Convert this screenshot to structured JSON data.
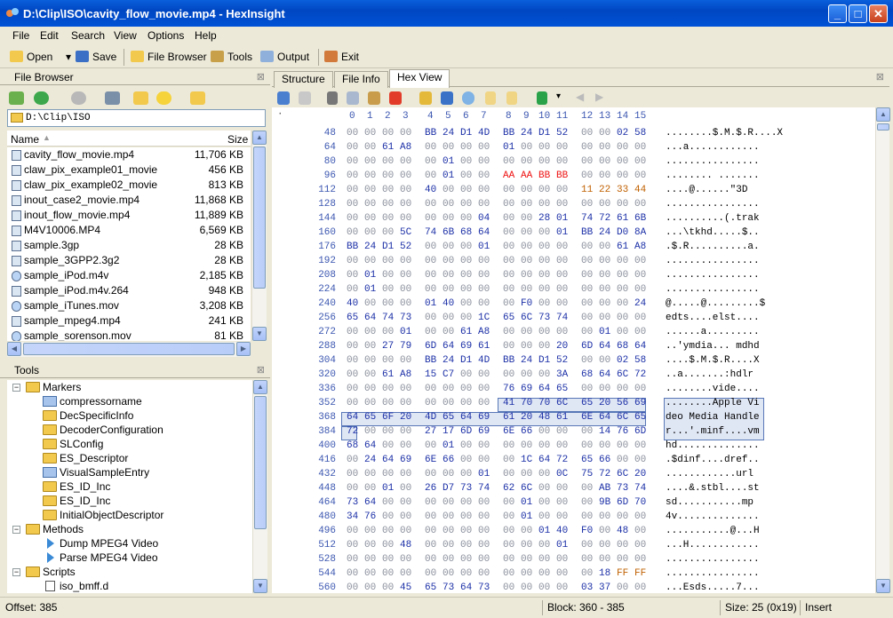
{
  "window": {
    "title": "D:\\Clip\\ISO\\cavity_flow_movie.mp4 - HexInsight"
  },
  "menu": [
    "File",
    "Edit",
    "Search",
    "View",
    "Options",
    "Help"
  ],
  "toolbar": {
    "open": "Open",
    "save": "Save",
    "file_browser": "File Browser",
    "tools": "Tools",
    "output": "Output",
    "exit": "Exit"
  },
  "file_browser": {
    "title": "File Browser",
    "path": "D:\\Clip\\ISO",
    "col_name": "Name",
    "col_size": "Size",
    "files": [
      {
        "name": "cavity_flow_movie.mp4",
        "size": "11,706 KB",
        "icon": "video-file-icon"
      },
      {
        "name": "claw_pix_example01_movie....",
        "size": "456 KB",
        "icon": "video-file-icon"
      },
      {
        "name": "claw_pix_example02_movie....",
        "size": "813 KB",
        "icon": "video-file-icon"
      },
      {
        "name": "inout_case2_movie.mp4",
        "size": "11,868 KB",
        "icon": "video-file-icon"
      },
      {
        "name": "inout_flow_movie.mp4",
        "size": "11,889 KB",
        "icon": "video-file-icon"
      },
      {
        "name": "M4V10006.MP4",
        "size": "6,569 KB",
        "icon": "video-file-icon"
      },
      {
        "name": "sample.3gp",
        "size": "28 KB",
        "icon": "video-file-icon"
      },
      {
        "name": "sample_3GPP2.3g2",
        "size": "28 KB",
        "icon": "video-file-icon"
      },
      {
        "name": "sample_iPod.m4v",
        "size": "2,185 KB",
        "icon": "quicktime-icon"
      },
      {
        "name": "sample_iPod.m4v.264",
        "size": "948 KB",
        "icon": "video-file-icon"
      },
      {
        "name": "sample_iTunes.mov",
        "size": "3,208 KB",
        "icon": "quicktime-icon"
      },
      {
        "name": "sample_mpeg4.mp4",
        "size": "241 KB",
        "icon": "video-file-icon"
      },
      {
        "name": "sample_sorenson.mov",
        "size": "81 KB",
        "icon": "quicktime-icon"
      }
    ]
  },
  "tools_panel": {
    "title": "Tools",
    "nodes": [
      {
        "label": "Markers",
        "level": 0,
        "icon": "folder-icon",
        "expander": "−"
      },
      {
        "label": "compressorname",
        "level": 1,
        "icon": "block-icon"
      },
      {
        "label": "DecSpecificInfo",
        "level": 1,
        "icon": "folder-icon"
      },
      {
        "label": "DecoderConfiguration",
        "level": 1,
        "icon": "folder-icon"
      },
      {
        "label": "SLConfig",
        "level": 1,
        "icon": "folder-icon"
      },
      {
        "label": "ES_Descriptor",
        "level": 1,
        "icon": "folder-icon"
      },
      {
        "label": "VisualSampleEntry",
        "level": 1,
        "icon": "block-icon"
      },
      {
        "label": "ES_ID_Inc",
        "level": 1,
        "icon": "folder-icon"
      },
      {
        "label": "ES_ID_Inc",
        "level": 1,
        "icon": "folder-icon"
      },
      {
        "label": "InitialObjectDescriptor",
        "level": 1,
        "icon": "folder-icon"
      },
      {
        "label": "Methods",
        "level": 0,
        "icon": "folder-icon",
        "expander": "−"
      },
      {
        "label": "Dump MPEG4 Video",
        "level": 1,
        "icon": "play-icon"
      },
      {
        "label": "Parse MPEG4 Video",
        "level": 1,
        "icon": "play-icon"
      },
      {
        "label": "Scripts",
        "level": 0,
        "icon": "folder-icon",
        "expander": "−"
      },
      {
        "label": "iso_bmff.d",
        "level": 1,
        "icon": "document-icon"
      }
    ]
  },
  "tabs": [
    {
      "label": "Structure",
      "active": false
    },
    {
      "label": "File Info",
      "active": false
    },
    {
      "label": "Hex View",
      "active": true
    }
  ],
  "hex": {
    "columns": [
      "0",
      "1",
      "2",
      "3",
      "4",
      "5",
      "6",
      "7",
      "8",
      "9",
      "10",
      "11",
      "12",
      "13",
      "14",
      "15"
    ],
    "selection": "Apple Video Media Handler",
    "rows": [
      {
        "off": "48",
        "b": [
          "00",
          "00",
          "00",
          "00",
          "BB",
          "24",
          "D1",
          "4D",
          "BB",
          "24",
          "D1",
          "52",
          "00",
          "00",
          "02",
          "58"
        ],
        "a": "........$.M.$.R....X"
      },
      {
        "off": "64",
        "b": [
          "00",
          "00",
          "61",
          "A8",
          "00",
          "00",
          "00",
          "00",
          "01",
          "00",
          "00",
          "00",
          "00",
          "00",
          "00",
          "00"
        ],
        "a": "...a............"
      },
      {
        "off": "80",
        "b": [
          "00",
          "00",
          "00",
          "00",
          "00",
          "01",
          "00",
          "00",
          "00",
          "00",
          "00",
          "00",
          "00",
          "00",
          "00",
          "00"
        ],
        "a": "................"
      },
      {
        "off": "96",
        "b": [
          "00",
          "00",
          "00",
          "00",
          "00",
          "01",
          "00",
          "00",
          "AA",
          "AA",
          "BB",
          "BB",
          "00",
          "00",
          "00",
          "00"
        ],
        "a": "........ ....... "
      },
      {
        "off": "112",
        "b": [
          "00",
          "00",
          "00",
          "00",
          "40",
          "00",
          "00",
          "00",
          "00",
          "00",
          "00",
          "00",
          "11",
          "22",
          "33",
          "44"
        ],
        "a": "....@......\"3D"
      },
      {
        "off": "128",
        "b": [
          "00",
          "00",
          "00",
          "00",
          "00",
          "00",
          "00",
          "00",
          "00",
          "00",
          "00",
          "00",
          "00",
          "00",
          "00",
          "00"
        ],
        "a": "................"
      },
      {
        "off": "144",
        "b": [
          "00",
          "00",
          "00",
          "00",
          "00",
          "00",
          "00",
          "04",
          "00",
          "00",
          "28",
          "01",
          "74",
          "72",
          "61",
          "6B"
        ],
        "a": "..........(.trak"
      },
      {
        "off": "160",
        "b": [
          "00",
          "00",
          "00",
          "5C",
          "74",
          "6B",
          "68",
          "64",
          "00",
          "00",
          "00",
          "01",
          "BB",
          "24",
          "D0",
          "8A"
        ],
        "a": "...\\tkhd.....$.."
      },
      {
        "off": "176",
        "b": [
          "BB",
          "24",
          "D1",
          "52",
          "00",
          "00",
          "00",
          "01",
          "00",
          "00",
          "00",
          "00",
          "00",
          "00",
          "61",
          "A8"
        ],
        "a": ".$.R..........a."
      },
      {
        "off": "192",
        "b": [
          "00",
          "00",
          "00",
          "00",
          "00",
          "00",
          "00",
          "00",
          "00",
          "00",
          "00",
          "00",
          "00",
          "00",
          "00",
          "00"
        ],
        "a": "................"
      },
      {
        "off": "208",
        "b": [
          "00",
          "01",
          "00",
          "00",
          "00",
          "00",
          "00",
          "00",
          "00",
          "00",
          "00",
          "00",
          "00",
          "00",
          "00",
          "00"
        ],
        "a": "................"
      },
      {
        "off": "224",
        "b": [
          "00",
          "01",
          "00",
          "00",
          "00",
          "00",
          "00",
          "00",
          "00",
          "00",
          "00",
          "00",
          "00",
          "00",
          "00",
          "00"
        ],
        "a": "................"
      },
      {
        "off": "240",
        "b": [
          "40",
          "00",
          "00",
          "00",
          "01",
          "40",
          "00",
          "00",
          "00",
          "F0",
          "00",
          "00",
          "00",
          "00",
          "00",
          "24"
        ],
        "a": "@.....@.........$"
      },
      {
        "off": "256",
        "b": [
          "65",
          "64",
          "74",
          "73",
          "00",
          "00",
          "00",
          "1C",
          "65",
          "6C",
          "73",
          "74",
          "00",
          "00",
          "00",
          "00"
        ],
        "a": "edts....elst...."
      },
      {
        "off": "272",
        "b": [
          "00",
          "00",
          "00",
          "01",
          "00",
          "00",
          "61",
          "A8",
          "00",
          "00",
          "00",
          "00",
          "00",
          "01",
          "00",
          "00"
        ],
        "a": "......a........."
      },
      {
        "off": "288",
        "b": [
          "00",
          "00",
          "27",
          "79",
          "6D",
          "64",
          "69",
          "61",
          "00",
          "00",
          "00",
          "20",
          "6D",
          "64",
          "68",
          "64"
        ],
        "a": "..'ymdia... mdhd"
      },
      {
        "off": "304",
        "b": [
          "00",
          "00",
          "00",
          "00",
          "BB",
          "24",
          "D1",
          "4D",
          "BB",
          "24",
          "D1",
          "52",
          "00",
          "00",
          "02",
          "58"
        ],
        "a": "....$.M.$.R....X"
      },
      {
        "off": "320",
        "b": [
          "00",
          "00",
          "61",
          "A8",
          "15",
          "C7",
          "00",
          "00",
          "00",
          "00",
          "00",
          "3A",
          "68",
          "64",
          "6C",
          "72"
        ],
        "a": "..a.......:hdlr"
      },
      {
        "off": "336",
        "b": [
          "00",
          "00",
          "00",
          "00",
          "00",
          "00",
          "00",
          "00",
          "76",
          "69",
          "64",
          "65",
          "00",
          "00",
          "00",
          "00"
        ],
        "a": "........vide...."
      },
      {
        "off": "352",
        "b": [
          "00",
          "00",
          "00",
          "00",
          "00",
          "00",
          "00",
          "00",
          "41",
          "70",
          "70",
          "6C",
          "65",
          "20",
          "56",
          "69"
        ],
        "a": "........Apple Vi"
      },
      {
        "off": "368",
        "b": [
          "64",
          "65",
          "6F",
          "20",
          "4D",
          "65",
          "64",
          "69",
          "61",
          "20",
          "48",
          "61",
          "6E",
          "64",
          "6C",
          "65"
        ],
        "a": "deo Media Handle"
      },
      {
        "off": "384",
        "b": [
          "72",
          "00",
          "00",
          "00",
          "27",
          "17",
          "6D",
          "69",
          "6E",
          "66",
          "00",
          "00",
          "00",
          "14",
          "76",
          "6D"
        ],
        "a": "r...'.minf....vm"
      },
      {
        "off": "400",
        "b": [
          "68",
          "64",
          "00",
          "00",
          "00",
          "01",
          "00",
          "00",
          "00",
          "00",
          "00",
          "00",
          "00",
          "00",
          "00",
          "00"
        ],
        "a": "hd.............."
      },
      {
        "off": "416",
        "b": [
          "00",
          "24",
          "64",
          "69",
          "6E",
          "66",
          "00",
          "00",
          "00",
          "1C",
          "64",
          "72",
          "65",
          "66",
          "00",
          "00"
        ],
        "a": ".$dinf....dref.."
      },
      {
        "off": "432",
        "b": [
          "00",
          "00",
          "00",
          "00",
          "00",
          "00",
          "00",
          "01",
          "00",
          "00",
          "00",
          "0C",
          "75",
          "72",
          "6C",
          "20"
        ],
        "a": "............url "
      },
      {
        "off": "448",
        "b": [
          "00",
          "00",
          "01",
          "00",
          "26",
          "D7",
          "73",
          "74",
          "62",
          "6C",
          "00",
          "00",
          "00",
          "AB",
          "73",
          "74"
        ],
        "a": "....&.stbl....st"
      },
      {
        "off": "464",
        "b": [
          "73",
          "64",
          "00",
          "00",
          "00",
          "00",
          "00",
          "00",
          "00",
          "01",
          "00",
          "00",
          "00",
          "9B",
          "6D",
          "70"
        ],
        "a": "sd...........mp"
      },
      {
        "off": "480",
        "b": [
          "34",
          "76",
          "00",
          "00",
          "00",
          "00",
          "00",
          "00",
          "00",
          "01",
          "00",
          "00",
          "00",
          "00",
          "00",
          "00"
        ],
        "a": "4v.............."
      },
      {
        "off": "496",
        "b": [
          "00",
          "00",
          "00",
          "00",
          "00",
          "00",
          "00",
          "00",
          "00",
          "00",
          "01",
          "40",
          "F0",
          "00",
          "48",
          "00"
        ],
        "a": "...........@...H"
      },
      {
        "off": "512",
        "b": [
          "00",
          "00",
          "00",
          "48",
          "00",
          "00",
          "00",
          "00",
          "00",
          "00",
          "00",
          "01",
          "00",
          "00",
          "00",
          "00"
        ],
        "a": "...H............"
      },
      {
        "off": "528",
        "b": [
          "00",
          "00",
          "00",
          "00",
          "00",
          "00",
          "00",
          "00",
          "00",
          "00",
          "00",
          "00",
          "00",
          "00",
          "00",
          "00"
        ],
        "a": "................"
      },
      {
        "off": "544",
        "b": [
          "00",
          "00",
          "00",
          "00",
          "00",
          "00",
          "00",
          "00",
          "00",
          "00",
          "00",
          "00",
          "00",
          "18",
          "FF",
          "FF"
        ],
        "a": "................"
      },
      {
        "off": "560",
        "b": [
          "00",
          "00",
          "00",
          "45",
          "65",
          "73",
          "64",
          "73",
          "00",
          "00",
          "00",
          "00",
          "03",
          "37",
          "00",
          "00"
        ],
        "a": "...Esds.....7..."
      }
    ]
  },
  "status": {
    "offset": "Offset: 385",
    "block": "Block: 360 - 385",
    "size": "Size: 25 (0x19)",
    "mode": "Insert"
  },
  "colors": {
    "titlebar": "#0a5fdb",
    "offset_text": "#3b56b0",
    "hex_text": "#1b2fa6",
    "highlight_red": "#ee1111",
    "highlight_orange": "#c06000"
  }
}
